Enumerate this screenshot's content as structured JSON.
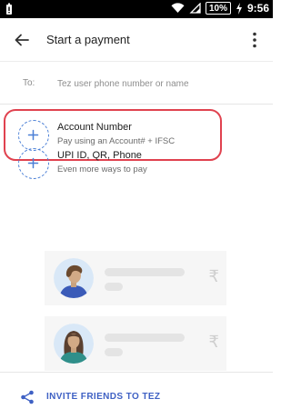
{
  "status_bar": {
    "battery_percent": "10%",
    "time": "9:56"
  },
  "header": {
    "title": "Start a payment"
  },
  "recipient": {
    "label": "To:",
    "placeholder": "Tez user phone number or name",
    "value": ""
  },
  "options": [
    {
      "title": "Account Number",
      "subtitle": "Pay using an Account# + IFSC",
      "highlighted": true
    },
    {
      "title": "UPI ID, QR, Phone",
      "subtitle": "Even more ways to pay",
      "highlighted": false
    }
  ],
  "contacts_placeholder": {
    "currency_symbol": "₹"
  },
  "footer": {
    "invite_label": "INVITE FRIENDS TO TEZ"
  },
  "colors": {
    "accent": "#3f61c4",
    "highlight": "#e0424f",
    "dashed_circle": "#4a7fd6"
  }
}
